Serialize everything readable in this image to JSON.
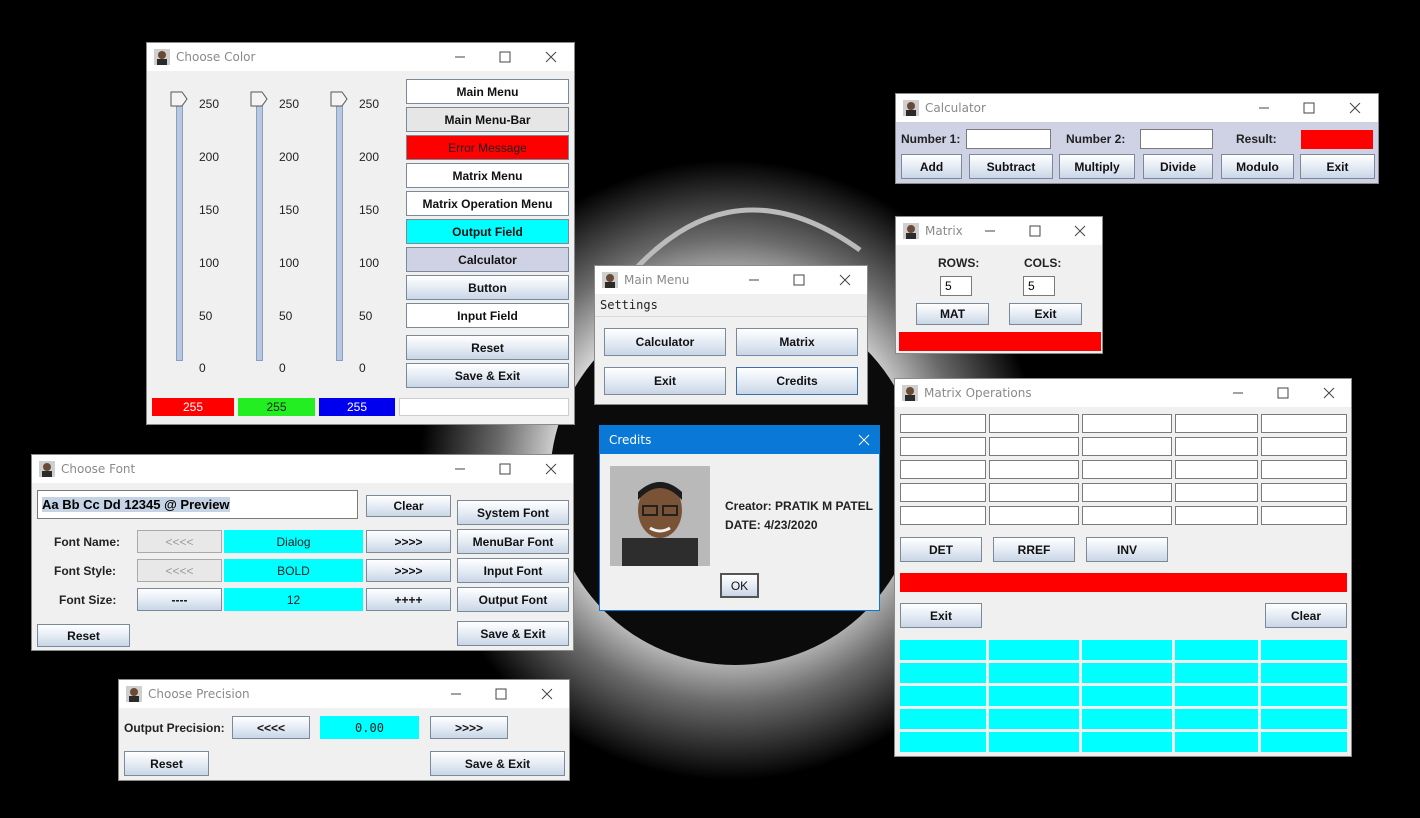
{
  "colors": {
    "red": "#ff0000",
    "cyan": "#00ffff",
    "lavender": "#cfd2e4",
    "titlebar": "#ffffff",
    "credits_titlebar": "#0a78d7"
  },
  "choose_color": {
    "title": "Choose Color",
    "slider_ticks": [
      "250",
      "200",
      "150",
      "100",
      "50",
      "0"
    ],
    "sliders": [
      {
        "name": "red",
        "value": 255
      },
      {
        "name": "green",
        "value": 255
      },
      {
        "name": "blue",
        "value": 255
      }
    ],
    "value_boxes": [
      "255",
      "255",
      "255"
    ],
    "buttons": [
      "Main Menu",
      "Main Menu-Bar",
      "Error Message",
      "Matrix Menu",
      "Matrix Operation Menu",
      "Output Field",
      "Calculator",
      "Button",
      "Input Field",
      "Reset",
      "Save & Exit"
    ]
  },
  "calculator": {
    "title": "Calculator",
    "number1_label": "Number 1:",
    "number2_label": "Number 2:",
    "result_label": "Result:",
    "buttons": [
      "Add",
      "Subtract",
      "Multiply",
      "Divide",
      "Modulo",
      "Exit"
    ]
  },
  "matrix": {
    "title": "Matrix",
    "rows_label": "ROWS:",
    "cols_label": "COLS:",
    "rows_value": "5",
    "cols_value": "5",
    "mat_button": "MAT",
    "exit_button": "Exit"
  },
  "main_menu": {
    "title": "Main Menu",
    "menu_settings": "Settings",
    "buttons": [
      "Calculator",
      "Matrix",
      "Exit",
      "Credits"
    ]
  },
  "credits": {
    "title": "Credits",
    "creator": "Creator: PRATIK M PATEL",
    "date": "DATE: 4/23/2020",
    "ok_button": "OK"
  },
  "matrix_operations": {
    "title": "Matrix Operations",
    "buttons": [
      "DET",
      "RREF",
      "INV"
    ],
    "exit_button": "Exit",
    "clear_button": "Clear"
  },
  "choose_font": {
    "title": "Choose Font",
    "preview": "Aa Bb Cc Dd 12345 @ Preview",
    "clear_button": "Clear",
    "font_name_label": "Font Name:",
    "font_style_label": "Font Style:",
    "font_size_label": "Font Size:",
    "prev_button": "<<<<",
    "next_button": ">>>>",
    "dec_button": "----",
    "inc_button": "++++",
    "font_name": "Dialog",
    "font_style": "BOLD",
    "font_size": "12",
    "side_buttons": [
      "System Font",
      "MenuBar Font",
      "Input Font",
      "Output Font"
    ],
    "reset_button": "Reset",
    "save_exit_button": "Save & Exit"
  },
  "choose_precision": {
    "title": "Choose Precision",
    "label": "Output Precision:",
    "prev_button": "<<<<",
    "value": "0.00",
    "next_button": ">>>>",
    "reset_button": "Reset",
    "save_exit_button": "Save & Exit"
  }
}
